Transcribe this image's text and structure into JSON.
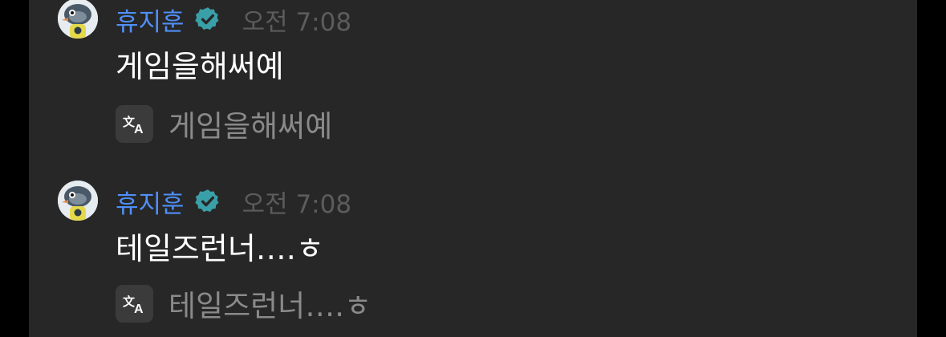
{
  "messages": [
    {
      "username": "휴지훈",
      "verified_icon": "verified-badge-icon",
      "timestamp": "오전 7:08",
      "text": "게임을해써예",
      "translate_icon": "translate-icon",
      "translation": "게임을해써예"
    },
    {
      "username": "휴지훈",
      "verified_icon": "verified-badge-icon",
      "timestamp": "오전 7:08",
      "text": "테일즈런너….ㅎ",
      "translate_icon": "translate-icon",
      "translation": "테일즈런너….ㅎ"
    }
  ],
  "colors": {
    "background": "#272727",
    "username": "#4f8ff7",
    "verified_badge": "#3aa0a8",
    "timestamp": "#5c5c5c",
    "message_text": "#ffffff",
    "translation_text": "#8a8a8a",
    "translate_button": "#3b3b3b"
  }
}
